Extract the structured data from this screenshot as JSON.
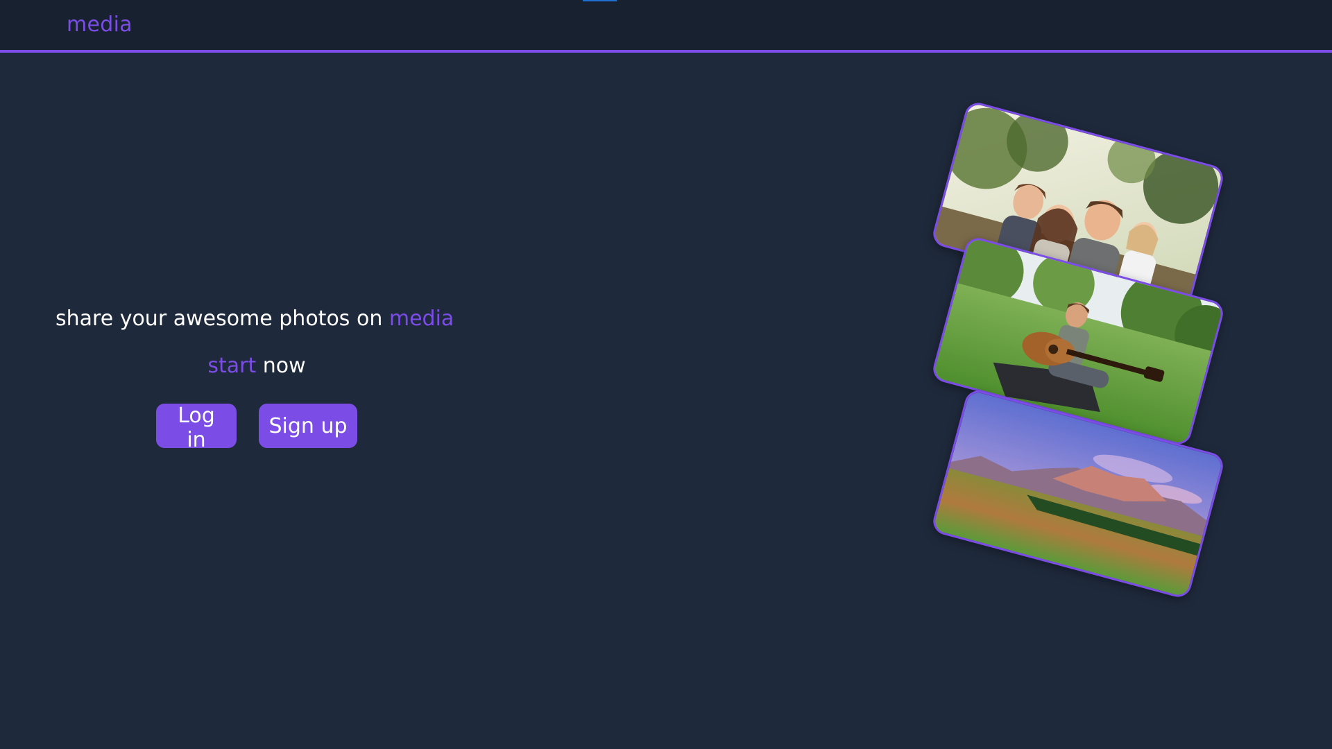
{
  "header": {
    "logo": "media"
  },
  "hero": {
    "tagline_prefix": "share your awesome photos on ",
    "tagline_brand": "media",
    "cta_accent": "start",
    "cta_rest": " now"
  },
  "actions": {
    "login_label": "Log in",
    "signup_label": "Sign up"
  },
  "colors": {
    "background": "#1e293b",
    "topbar": "#182130",
    "accent": "#7b4de6",
    "text": "#ffffff"
  },
  "photos": [
    {
      "subject": "family-portrait"
    },
    {
      "subject": "guitar-player-on-grass"
    },
    {
      "subject": "mountain-landscape"
    }
  ]
}
